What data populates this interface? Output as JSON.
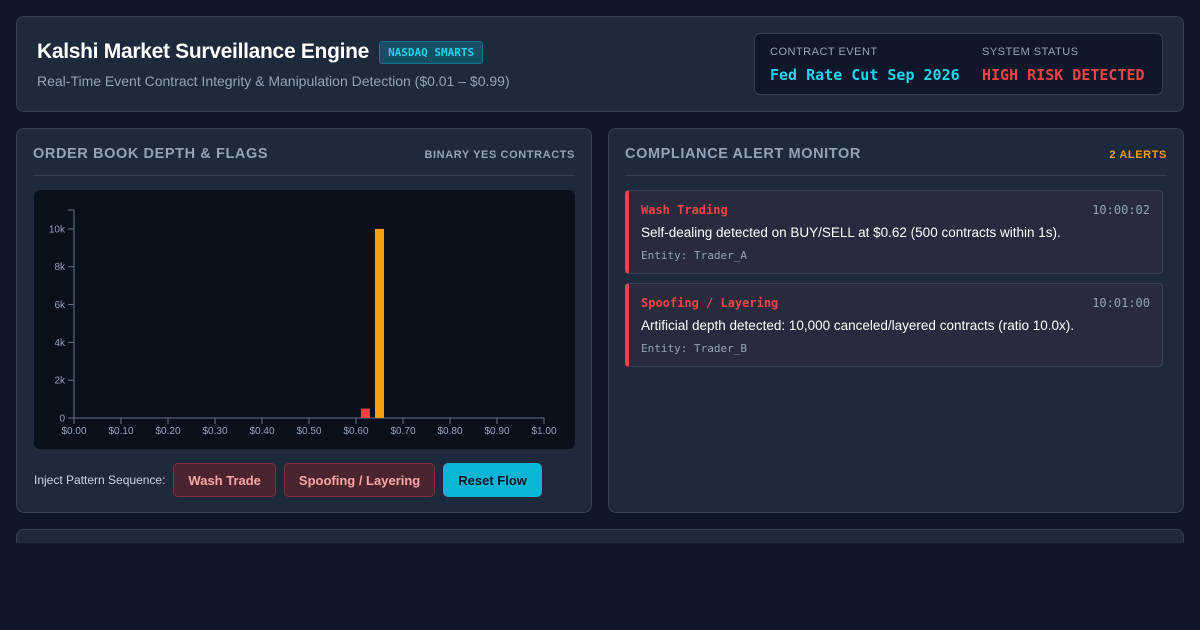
{
  "header": {
    "title": "Kalshi Market Surveillance Engine",
    "badge": "NASDAQ SMARTS",
    "subtitle": "Real-Time Event Contract Integrity & Manipulation Detection ($0.01 – $0.99)",
    "contract_event_label": "CONTRACT EVENT",
    "contract_event_value": "Fed Rate Cut Sep 2026",
    "system_status_label": "SYSTEM STATUS",
    "system_status_value": "HIGH RISK DETECTED"
  },
  "order_book": {
    "title": "ORDER BOOK DEPTH & FLAGS",
    "tag": "BINARY YES CONTRACTS",
    "controls_label": "Inject Pattern Sequence:",
    "buttons": {
      "wash": "Wash Trade",
      "spoof": "Spoofing / Layering",
      "reset": "Reset Flow"
    }
  },
  "chart_data": {
    "type": "bar",
    "x_ticks": [
      "$0.00",
      "$0.10",
      "$0.20",
      "$0.30",
      "$0.40",
      "$0.50",
      "$0.60",
      "$0.70",
      "$0.80",
      "$0.90",
      "$1.00"
    ],
    "y_ticks": [
      "0",
      "2k",
      "4k",
      "6k",
      "8k",
      "10k"
    ],
    "xlim": [
      0,
      1.0
    ],
    "ylim": [
      0,
      11000
    ],
    "bars": [
      {
        "price": 0.62,
        "volume": 500,
        "color": "#ef4444"
      },
      {
        "price": 0.65,
        "volume": 10000,
        "color": "#f59e0b"
      }
    ],
    "grid": false
  },
  "alerts_panel": {
    "title": "COMPLIANCE ALERT MONITOR",
    "count_label": "2 ALERTS",
    "alerts": [
      {
        "type": "Wash Trading",
        "time": "10:00:02",
        "message": "Self-dealing detected on BUY/SELL at $0.62 (500 contracts within 1s).",
        "entity": "Entity: Trader_A"
      },
      {
        "type": "Spoofing / Layering",
        "time": "10:01:00",
        "message": "Artificial depth detected: 10,000 canceled/layered contracts (ratio 10.0x).",
        "entity": "Entity: Trader_B"
      }
    ]
  },
  "colors": {
    "accent": "#22d3ee",
    "danger": "#ef4444",
    "warning": "#f59e0b",
    "background": "#0f172a",
    "panel": "#1e293b"
  }
}
